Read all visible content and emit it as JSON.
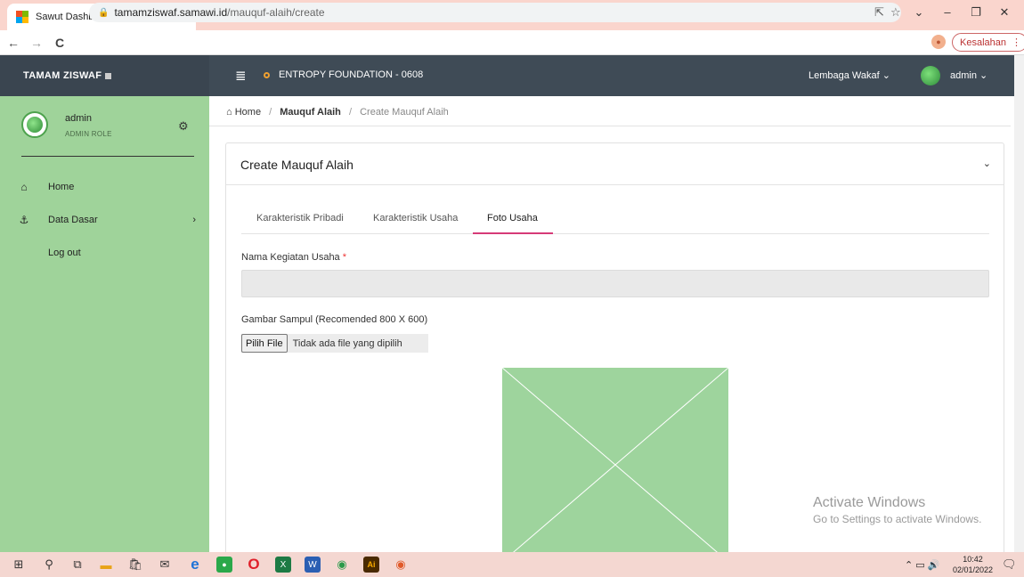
{
  "browser": {
    "tab_title": "Sawut Dashboard",
    "tab_close": "×",
    "new_tab": "+",
    "url_host": "tamamziswaf.samawi.id",
    "url_path": "/mauquf-alaih/create",
    "error_button": "Kesalahan"
  },
  "topnav": {
    "brand": "TAMAM ZISWAF",
    "organization": "ENTROPY FOUNDATION - 0608",
    "lembaga_dropdown": "Lembaga Wakaf",
    "user_dropdown": "admin"
  },
  "sidebar": {
    "user_name": "admin",
    "user_role": "ADMIN ROLE",
    "items": [
      {
        "label": "Home",
        "icon": "home-icon"
      },
      {
        "label": "Data Dasar",
        "icon": "anchor-icon"
      },
      {
        "label": "Log out",
        "icon": ""
      }
    ]
  },
  "breadcrumb": {
    "home": "Home",
    "section": "Mauquf Alaih",
    "current": "Create Mauquf Alaih"
  },
  "card": {
    "title": "Create Mauquf Alaih",
    "tabs": [
      "Karakteristik Pribadi",
      "Karakteristik Usaha",
      "Foto Usaha"
    ],
    "active_tab": "Foto Usaha"
  },
  "form": {
    "nama_label": "Nama Kegiatan Usaha",
    "nama_required": "*",
    "nama_value": "",
    "gambar_label": "Gambar Sampul (Recomended 800 X 600)",
    "file_button": "Pilih File",
    "file_status": "Tidak ada file yang dipilih"
  },
  "watermark": {
    "line1": "Activate Windows",
    "line2": "Go to Settings to activate Windows."
  },
  "taskbar": {
    "time": "10:42",
    "date": "02/01/2022"
  },
  "colors": {
    "sidebar_bg": "#9fd39a",
    "topnav_bg": "#3f4b56",
    "active_tab_underline": "#d63a78",
    "browser_chrome": "#fad5cd"
  }
}
